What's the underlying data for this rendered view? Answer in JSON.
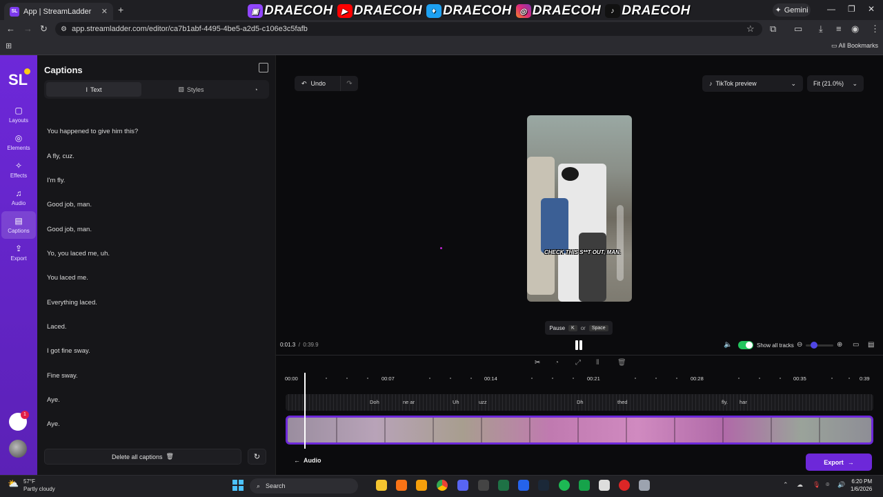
{
  "browser": {
    "tab_title": "App | StreamLadder",
    "favicon_text": "SL",
    "banner_handles": [
      "DRAECOH",
      "DRAECOH",
      "DRAECOH",
      "DRAECOH",
      "DRAECOH"
    ],
    "gemini_label": "Gemini",
    "url": "app.streamladder.com/editor/ca7b1abf-4495-4be5-a2d5-c106e3c5fafb",
    "all_bookmarks": "All Bookmarks"
  },
  "rail": {
    "logo": "SL",
    "items": [
      {
        "label": "Layouts",
        "icon": "layout-icon"
      },
      {
        "label": "Elements",
        "icon": "elements-icon"
      },
      {
        "label": "Effects",
        "icon": "effects-icon"
      },
      {
        "label": "Audio",
        "icon": "music-note-icon"
      },
      {
        "label": "Captions",
        "icon": "captions-icon"
      },
      {
        "label": "Export",
        "icon": "export-icon"
      }
    ],
    "notification_count": "1"
  },
  "captions_panel": {
    "title": "Captions",
    "tab_text": "Text",
    "tab_styles": "Styles",
    "captions": [
      "You happened to give him this?",
      "A fly, cuz.",
      "I'm fly.",
      "Good job, man.",
      "Good job, man.",
      "Yo, you laced me, uh.",
      "You laced me.",
      "Everything laced.",
      "Laced.",
      "I got fine sway.",
      "Fine sway.",
      "Aye.",
      "Aye."
    ],
    "delete_all": "Delete all captions"
  },
  "editor": {
    "undo": "Undo",
    "preview_select": "TikTok preview",
    "fit_select": "Fit (21.0%)",
    "video_subtitle": "CHECK THIS S**T OUT, MAN.",
    "pause_hint": {
      "label": "Pause",
      "key1": "K",
      "or": "or",
      "key2": "Space"
    },
    "current_time": "0:01.3",
    "separator": "/",
    "total_time": "0:39.9",
    "show_all_tracks": "Show all tracks",
    "ticks": [
      "00:00",
      "00:07",
      "00:14",
      "00:21",
      "00:28",
      "00:35",
      "0:39"
    ],
    "caption_chunks": [
      "Doh",
      "ne ar",
      "Uh",
      "uzz",
      "Dh",
      "thed",
      "fly.",
      "har"
    ],
    "audio": "Audio",
    "export": "Export"
  },
  "taskbar": {
    "temp": "57°F",
    "weather": "Partly cloudy",
    "search": "Search",
    "time": "6:20 PM",
    "date": "1/6/2026"
  },
  "colors": {
    "accent": "#6d28d9",
    "toggle": "#22c55e",
    "brand_yellow": "#facc15"
  }
}
